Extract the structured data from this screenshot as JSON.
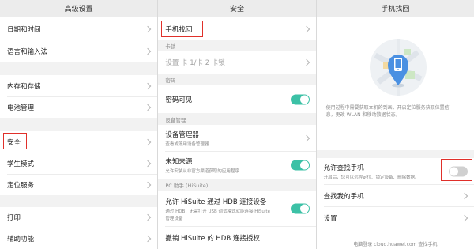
{
  "panel1": {
    "title": "高级设置",
    "items": [
      {
        "label": "日期和时间"
      },
      {
        "label": "语言和输入法"
      },
      {
        "label": "内存和存储"
      },
      {
        "label": "电池管理"
      },
      {
        "label": "安全"
      },
      {
        "label": "学生模式"
      },
      {
        "label": "定位服务"
      },
      {
        "label": "打印"
      },
      {
        "label": "辅助功能"
      }
    ]
  },
  "panel2": {
    "title": "安全",
    "phone_finder": "手机找回",
    "sim_section": "卡锁",
    "sim_lock": "设置 卡 1/卡 2 卡锁",
    "password_section": "密码",
    "password_visible": "密码可见",
    "device_section": "设备管理",
    "device_manager": "设备管理器",
    "device_manager_sub": "查看或停用设备管理器",
    "unknown_sources": "未知来源",
    "unknown_sources_sub": "允许安装从非官方渠道获取的应用程序",
    "hisuite_section": "PC 助手 (HiSuite)",
    "hisuite_hdb": "允许 HiSuite 通过 HDB 连接设备",
    "hisuite_hdb_sub1": "通过 HDB，无需打开 USB 调试模式就能连接 HiSuite",
    "hisuite_hdb_sub2": "管理设备",
    "revoke_hdb": "撤销 HiSuite 的 HDB 连接授权"
  },
  "panel3": {
    "title": "手机找回",
    "description_line1": "使用过程中需要获取本机的到画，开启定位服务获取位置信",
    "description_line2": "息，更改 WLAN 和移动数据状态。",
    "allow_find": "允许查找手机",
    "allow_find_sub": "开启后，您可以远程定位、锁定设备、删除数据。",
    "find_my_phone": "查找我的手机",
    "settings": "设置",
    "footer": "电脑登录 cloud.huawei.com 查找手机"
  },
  "colors": {
    "toggle_on": "#3cc1a6",
    "toggle_off": "#d0d0d0",
    "highlight": "#e0302a",
    "pin": "#4a90e2"
  },
  "toggles": {
    "password_visible": true,
    "unknown_sources": true,
    "hisuite_hdb": true,
    "allow_find": false
  }
}
